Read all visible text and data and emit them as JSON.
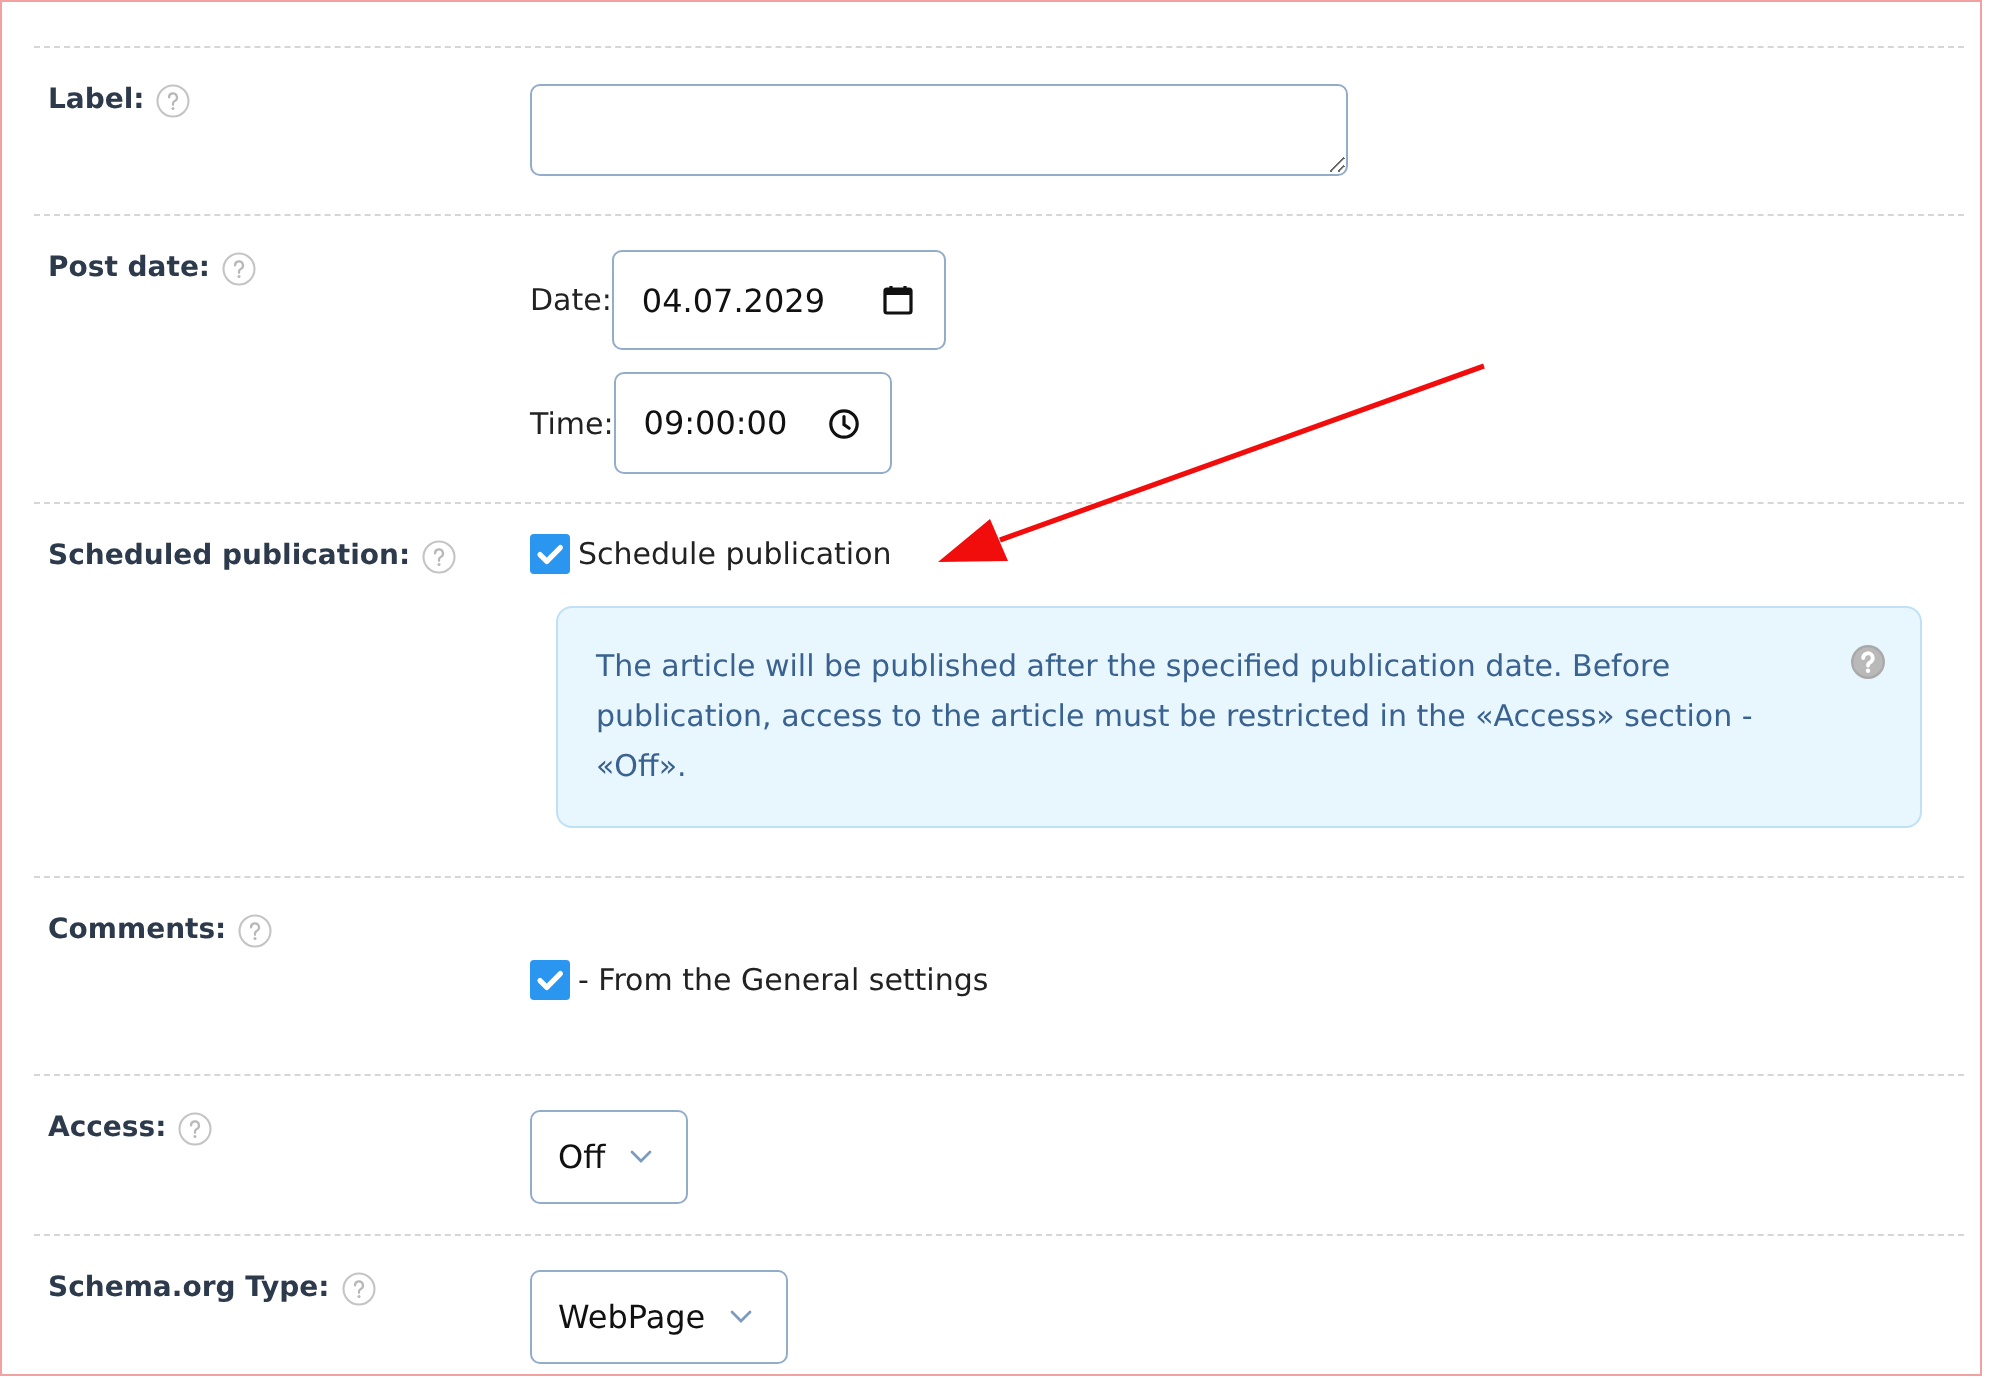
{
  "rows": [
    {
      "kind": "textarea",
      "label": "Label:"
    },
    {
      "kind": "datetime",
      "label": "Post date:",
      "date": {
        "label": "Date:",
        "value": "04.07.2029"
      },
      "time": {
        "label": "Time:",
        "value": "09:00:00"
      }
    },
    {
      "kind": "checkbox",
      "label": "Scheduled publication:",
      "checkbox": {
        "label": "Schedule publication",
        "checked": true
      },
      "note": "The article will be published after the specified publication date. Before publication, access to the article must be restricted in the «Access» section - «Off»."
    },
    {
      "kind": "checkbox",
      "label": "Comments:",
      "checkbox": {
        "label": "- From the General settings",
        "checked": true
      }
    },
    {
      "kind": "select",
      "label": "Access:",
      "select": {
        "value": "Off"
      }
    },
    {
      "kind": "select",
      "label": "Schema.org Type:",
      "select": {
        "value": "WebPage"
      }
    }
  ]
}
